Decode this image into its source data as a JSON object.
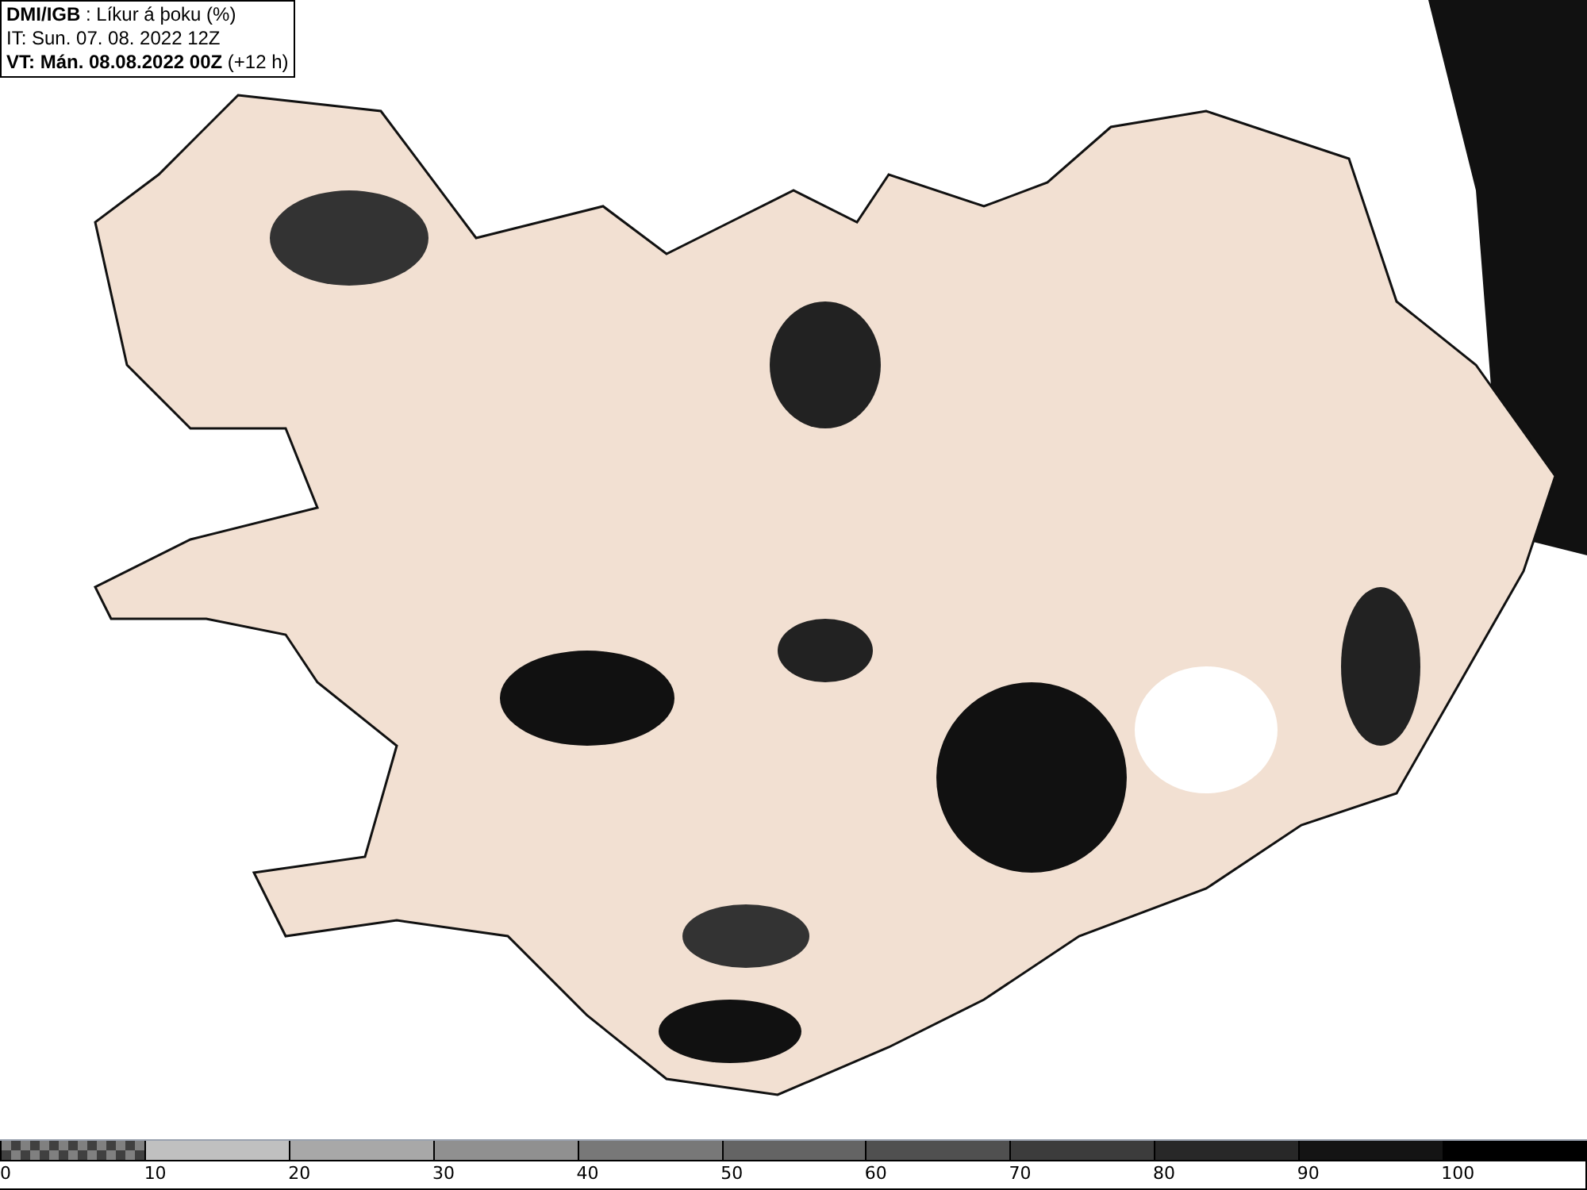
{
  "header": {
    "title": "**DMI/IGB** : Líkur á þoku (%)",
    "initial_time": "IT: Sun. 07. 08. 2022 12Z",
    "valid_time": "**VT: Mán. 08.08.2022 00Z** (+12 h)"
  },
  "legend": {
    "segments": [
      {
        "kind": "pattern",
        "color": "#808080"
      },
      {
        "kind": "solid",
        "color": "#c0c0c0"
      },
      {
        "kind": "solid",
        "color": "#a8a8a8"
      },
      {
        "kind": "solid",
        "color": "#909090"
      },
      {
        "kind": "solid",
        "color": "#787878"
      },
      {
        "kind": "solid",
        "color": "#646464"
      },
      {
        "kind": "solid",
        "color": "#505050"
      },
      {
        "kind": "solid",
        "color": "#3c3c3c"
      },
      {
        "kind": "solid",
        "color": "#282828"
      },
      {
        "kind": "solid",
        "color": "#141414"
      },
      {
        "kind": "solid",
        "color": "#000000"
      }
    ],
    "labels": [
      "0",
      "10",
      "20",
      "30",
      "40",
      "50",
      "60",
      "70",
      "80",
      "90",
      "100"
    ]
  }
}
